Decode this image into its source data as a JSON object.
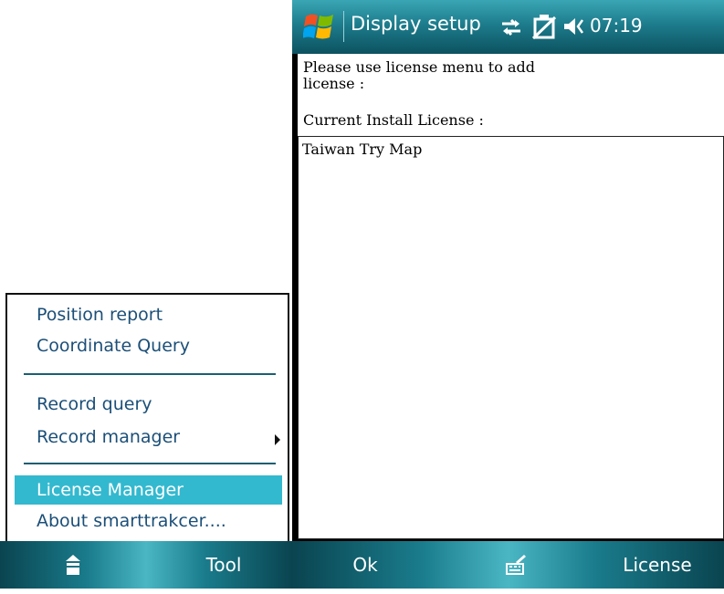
{
  "left_panel": {
    "menu": {
      "items": [
        {
          "label": "Position report"
        },
        {
          "label": "Coordinate Query"
        },
        {
          "label": "Record query"
        },
        {
          "label": "Record manager"
        },
        {
          "label": "License Manager"
        },
        {
          "label": "About smarttrakcer...."
        }
      ],
      "selected": "License Manager"
    },
    "softkeys": {
      "left_icon": "keyboard-icon",
      "right_label": "Tool"
    }
  },
  "right_panel": {
    "status_bar": {
      "title": "Display setup",
      "time": "07:19",
      "icons": [
        "windows-start-icon",
        "connectivity-icon",
        "battery-icon",
        "speaker-icon"
      ]
    },
    "content": {
      "instruction": "Please use license menu to add license :",
      "current_label": "Current Install License :",
      "licenses": [
        "Taiwan Try Map"
      ]
    },
    "softkeys": {
      "left_label": "Ok",
      "center_icon": "input-panel-icon",
      "right_label": "License"
    }
  },
  "colors": {
    "accent": "#33b9cf",
    "menu_text": "#1b4f78",
    "bar_dark": "#0a4450",
    "bar_light": "#4ab6c4"
  }
}
